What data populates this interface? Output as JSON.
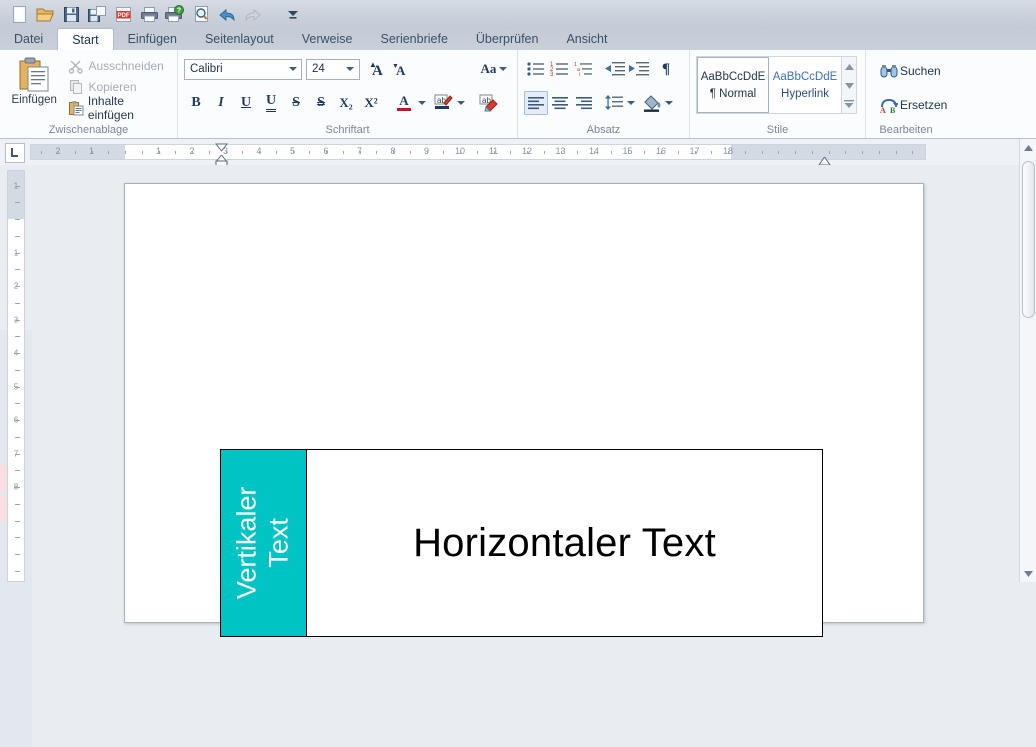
{
  "quick_access": {
    "items": [
      {
        "name": "new-document",
        "label": "Neu"
      },
      {
        "name": "open-document",
        "label": "Öffnen"
      },
      {
        "name": "save-document",
        "label": "Speichern"
      },
      {
        "name": "save-as-document",
        "label": "Speichern unter"
      },
      {
        "name": "export-pdf",
        "label": "PDF"
      },
      {
        "name": "print",
        "label": "Drucken"
      },
      {
        "name": "print-preview",
        "label": "Seitenansicht"
      },
      {
        "name": "find",
        "label": "Suchen"
      },
      {
        "name": "undo",
        "label": "Rückgängig"
      },
      {
        "name": "redo",
        "label": "Wiederholen"
      },
      {
        "name": "customize-toolbar",
        "label": "Anpassen"
      }
    ]
  },
  "tabs": [
    {
      "label": "Datei",
      "active": false
    },
    {
      "label": "Start",
      "active": true
    },
    {
      "label": "Einfügen",
      "active": false
    },
    {
      "label": "Seitenlayout",
      "active": false
    },
    {
      "label": "Verweise",
      "active": false
    },
    {
      "label": "Serienbriefe",
      "active": false
    },
    {
      "label": "Überprüfen",
      "active": false
    },
    {
      "label": "Ansicht",
      "active": false
    }
  ],
  "ribbon": {
    "clipboard": {
      "group_label": "Zwischenablage",
      "paste_label": "Einfügen",
      "cut_label": "Ausschneiden",
      "copy_label": "Kopieren",
      "paste_special_label": "Inhalte einfügen"
    },
    "font": {
      "group_label": "Schriftart",
      "font_name": "Calibri",
      "font_size": "24",
      "grow_font": "A",
      "shrink_font": "A",
      "change_case": "Aa",
      "bold": "B",
      "italic": "I",
      "underline": "U",
      "double_underline": "U",
      "strikethrough": "S",
      "double_strikethrough": "S",
      "subscript": "X₂",
      "superscript": "X²",
      "font_color": "A",
      "highlight": "ab",
      "clear_formatting": "ab"
    },
    "paragraph": {
      "group_label": "Absatz",
      "bullets": "Aufzählungszeichen",
      "numbering": "Nummerierung",
      "multilevel": "Liste mit mehreren Ebenen",
      "decrease_indent": "Einzug verkleinern",
      "increase_indent": "Einzug vergrößern",
      "show_marks": "¶",
      "align_left": "Linksbündig",
      "align_center": "Zentriert",
      "align_right": "Rechtsbündig",
      "line_spacing": "Zeilenabstand",
      "shading": "Schattierung"
    },
    "styles": {
      "group_label": "Stile",
      "items": [
        {
          "preview": "AaBbCcDdE",
          "name": "¶ Normal",
          "selected": true,
          "link": false
        },
        {
          "preview": "AaBbCcDdE",
          "name": "Hyperlink",
          "selected": false,
          "link": true
        }
      ]
    },
    "editing": {
      "group_label": "Bearbeiten",
      "find_label": "Suchen",
      "replace_label": "Ersetzen"
    }
  },
  "ruler": {
    "tab_stop_selector": "L",
    "horizontal_numbers": [
      "2",
      "1",
      "1",
      "2",
      "3",
      "4",
      "5",
      "6",
      "7",
      "8",
      "9",
      "10",
      "11",
      "12",
      "13",
      "14",
      "15",
      "16",
      "17",
      "18"
    ],
    "vertical_numbers": [
      "2",
      "1",
      "1",
      "2",
      "3",
      "4",
      "5",
      "6",
      "7",
      "8"
    ]
  },
  "document": {
    "table": {
      "vertical_cell": {
        "text": "Vertikaler Text",
        "line1": "Vertikaler",
        "line2": "Text",
        "background": "#00c4c4",
        "text_color": "#ffffff",
        "rotation": "-90"
      },
      "horizontal_cell": {
        "text": "Horizontaler Text",
        "text_color": "#000000"
      }
    }
  },
  "scrollbar": {
    "up_arrow": "▲",
    "down_arrow": "▼"
  }
}
